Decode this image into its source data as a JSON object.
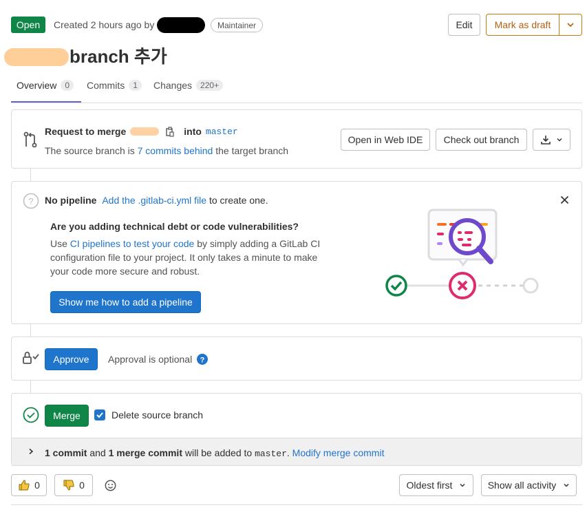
{
  "header": {
    "status": "Open",
    "created": "Created 2 hours ago by",
    "role_badge": "Maintainer",
    "edit_label": "Edit",
    "draft_label": "Mark as draft"
  },
  "title": "branch 추가",
  "tabs": [
    {
      "label": "Overview",
      "count": "0"
    },
    {
      "label": "Commits",
      "count": "1"
    },
    {
      "label": "Changes",
      "count": "220+"
    }
  ],
  "merge_request": {
    "request_label": "Request to merge",
    "into_label": "into",
    "target_branch": "master",
    "source_text_1": "The source branch is",
    "behind_link": "7 commits behind",
    "source_text_2": "the target branch",
    "web_ide_label": "Open in Web IDE",
    "checkout_label": "Check out branch"
  },
  "pipeline": {
    "title": "No pipeline",
    "add_link": "Add the .gitlab-ci.yml file",
    "add_suffix": "to create one.",
    "question": "Are you adding technical debt or code vulnerabilities?",
    "desc_prefix": "Use",
    "desc_link": "CI pipelines to test your code",
    "desc_line1": "by simply adding a GitLab CI",
    "desc_line2": "configuration file to your project. It only takes a minute to make",
    "desc_line3": "your code more secure and robust.",
    "cta": "Show me how to add a pipeline"
  },
  "approval": {
    "approve_label": "Approve",
    "optional_text": "Approval is optional"
  },
  "merge": {
    "merge_label": "Merge",
    "delete_source_label": "Delete source branch",
    "commit_count": "1 commit",
    "and": "and",
    "merge_commit_count": "1 merge commit",
    "will_be_added": "will be added to",
    "target": "master",
    "modify_link": "Modify merge commit"
  },
  "footer": {
    "thumbs_up": "0",
    "thumbs_down": "0",
    "sort_label": "Oldest first",
    "filter_label": "Show all activity"
  },
  "colors": {
    "brand_blue": "#1f75cb",
    "success_green": "#108548",
    "draft_orange": "#b5600f",
    "tab_underline": "#6666c4",
    "danger_red": "#dd2b6e"
  }
}
